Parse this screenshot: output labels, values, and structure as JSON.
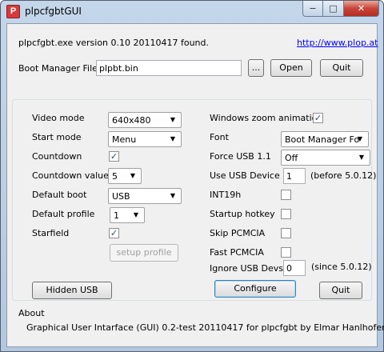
{
  "window": {
    "title": "plpcfgbtGUI",
    "icon_glyph": "P",
    "minimize_glyph": "−",
    "maximize_glyph": "□",
    "close_glyph": "✕"
  },
  "header": {
    "found_text": "plpcfgbt.exe version 0.10 20110417 found.",
    "link_text": "http://www.plop.at",
    "boot_manager_label": "Boot Manager File",
    "boot_manager_value": "plpbt.bin",
    "browse_label": "...",
    "open_label": "Open",
    "quit_label": "Quit"
  },
  "settings": {
    "video_mode_label": "Video mode",
    "video_mode_value": "640x480",
    "start_mode_label": "Start mode",
    "start_mode_value": "Menu",
    "countdown_label": "Countdown",
    "countdown_checked": "✓",
    "countdown_value_label": "Countdown value",
    "countdown_value": "5",
    "default_boot_label": "Default boot",
    "default_boot_value": "USB",
    "default_profile_label": "Default profile",
    "default_profile_value": "1",
    "starfield_label": "Starfield",
    "starfield_checked": "✓",
    "setup_profile_label": "setup profile",
    "win_zoom_label": "Windows zoom animation",
    "win_zoom_checked": "✓",
    "font_label": "Font",
    "font_value": "Boot Manager Fo",
    "force_usb_label": "Force USB 1.1",
    "force_usb_value": "Off",
    "use_usb_device_label": "Use USB Device",
    "use_usb_device_value": "1",
    "use_usb_device_note": "(before 5.0.12)",
    "int19h_label": "INT19h",
    "startup_hotkey_label": "Startup hotkey",
    "skip_pcmcia_label": "Skip PCMCIA",
    "fast_pcmcia_label": "Fast PCMCIA",
    "ignore_usb_devs_label": "Ignore USB Devs",
    "ignore_usb_devs_value": "0",
    "ignore_usb_devs_note": "(since 5.0.12)",
    "hidden_usb_label": "Hidden USB",
    "configure_label": "Configure",
    "quit_label": "Quit",
    "dropdown_arrow": "▼"
  },
  "about": {
    "label": "About",
    "text": "Graphical User Intarface (GUI) 0.2-test 20110417 for plpcfgbt by Elmar Hanlhofer"
  }
}
